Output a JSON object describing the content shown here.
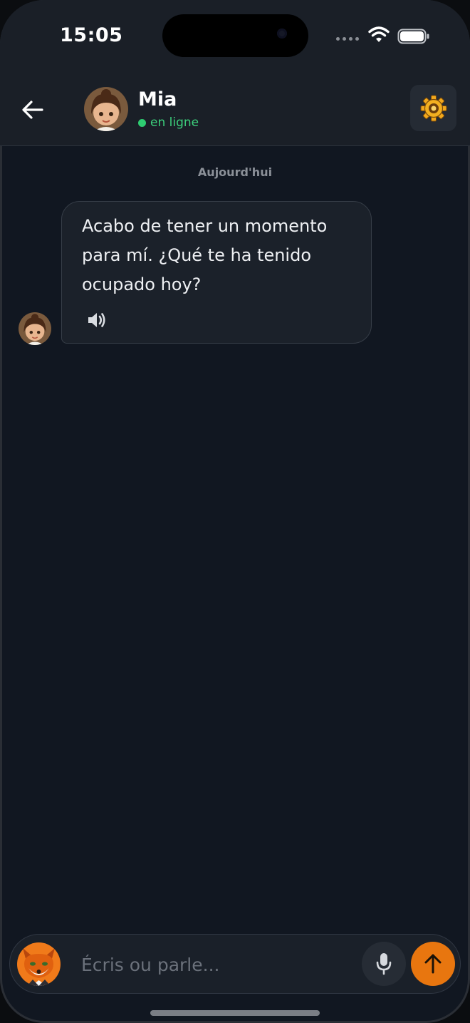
{
  "status_bar": {
    "time": "15:05"
  },
  "header": {
    "contact_name": "Mia",
    "presence": "en ligne",
    "icons": {
      "back": "arrow-left-icon",
      "settings": "gear-icon"
    }
  },
  "chat": {
    "date_separator": "Aujourd'hui",
    "messages": [
      {
        "sender": "Mia",
        "text": "Acabo de tener un momento para mí. ¿Qué te ha tenido ocupado hoy?",
        "action_icon": "speaker-icon"
      }
    ]
  },
  "input": {
    "placeholder": "Écris ou parle...",
    "value": "",
    "icons": {
      "mic": "microphone-icon",
      "send": "arrow-up-icon"
    }
  },
  "colors": {
    "background": "#111721",
    "header": "#1a1f27",
    "bubble": "#1b212a",
    "online": "#2ecc71",
    "send_button": "#e8760f"
  }
}
